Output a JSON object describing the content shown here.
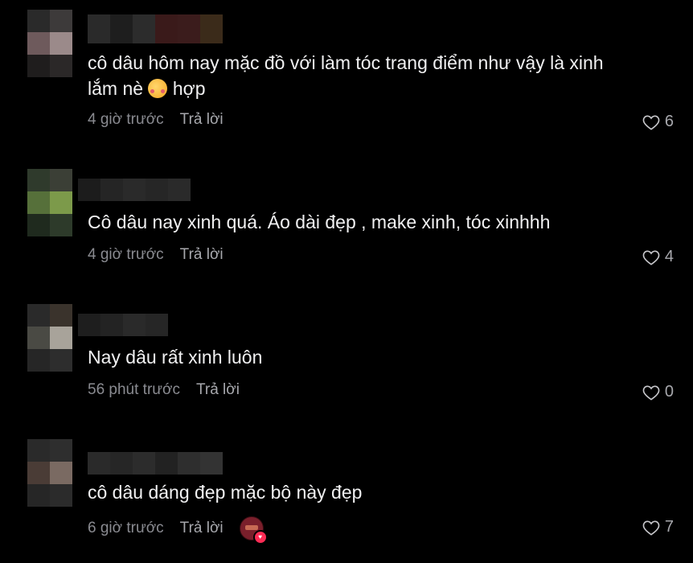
{
  "comments": [
    {
      "text_before_emoji": "cô dâu hôm nay mặc đồ với làm tóc trang điểm như vậy là xinh lắm nè ",
      "emoji": "smiling-face-with-hearts",
      "text_after_emoji": " hợp",
      "time": "4 giờ trước",
      "reply_label": "Trả lời",
      "likes": "6"
    },
    {
      "text": "Cô dâu nay xinh quá. Áo dài đẹp , make xinh, tóc xinhhh",
      "time": "4 giờ trước",
      "reply_label": "Trả lời",
      "likes": "4"
    },
    {
      "text": "Nay dâu rất xinh luôn",
      "time": "56 phút trước",
      "reply_label": "Trả lời",
      "likes": "0"
    },
    {
      "text": "cô dâu dáng đẹp mặc bộ này đẹp",
      "time": "6 giờ trước",
      "reply_label": "Trả lời",
      "likes": "7",
      "creator_liked": true
    }
  ],
  "colors": {
    "background": "#000000",
    "text": "#f1f1f2",
    "meta": "#8a8b91",
    "like_heart_creator": "#fe2c55"
  }
}
